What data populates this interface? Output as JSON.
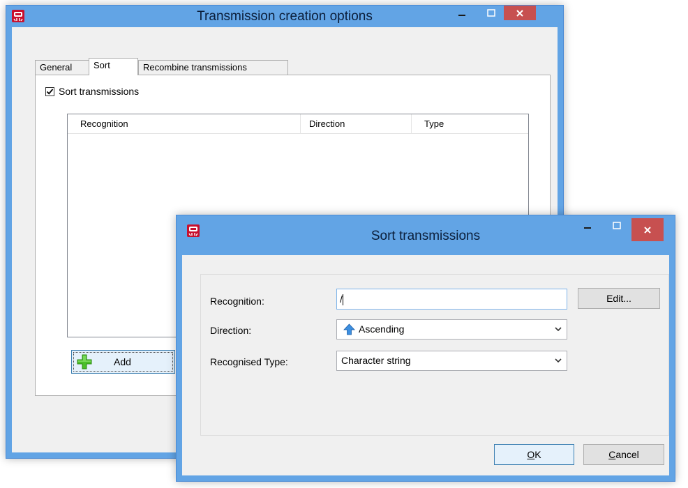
{
  "main_window": {
    "title": "Transmission creation options",
    "tabs": [
      {
        "label": "General"
      },
      {
        "label": "Sort",
        "active": true
      },
      {
        "label": "Recombine transmissions"
      }
    ],
    "sort_checkbox": {
      "label": "Sort transmissions",
      "checked": true
    },
    "list_columns": [
      "Recognition",
      "Direction",
      "Type"
    ],
    "add_button": "Add"
  },
  "dialog": {
    "title": "Sort transmissions",
    "recognition_label": "Recognition:",
    "recognition_value": "/",
    "edit_button": "Edit...",
    "direction_label": "Direction:",
    "direction_value": "Ascending",
    "type_label": "Recognised Type:",
    "type_value": "Character string",
    "ok_button": {
      "prefix": "",
      "accel": "O",
      "rest": "K"
    },
    "cancel_button": {
      "prefix": "",
      "accel": "C",
      "rest": "ancel"
    }
  },
  "colors": {
    "titlebar": "#62a4e5",
    "close": "#c75050",
    "client": "#f0f0f0"
  },
  "icons": [
    "app-icon",
    "minimize-icon",
    "maximize-icon",
    "close-icon",
    "checkmark-icon",
    "add-plus-icon",
    "arrow-up-icon",
    "chevron-down-icon"
  ]
}
